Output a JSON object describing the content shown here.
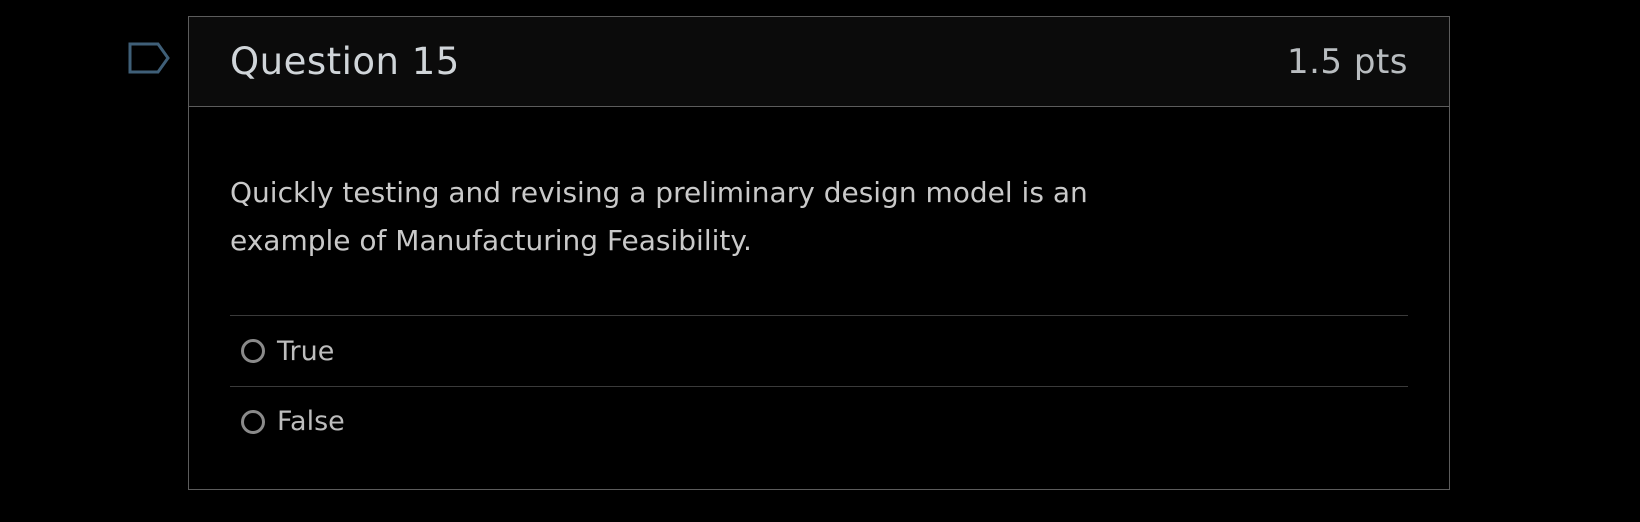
{
  "question": {
    "title": "Question 15",
    "points": "1.5 pts",
    "text_line1": "Quickly testing and revising a preliminary design model is an",
    "text_line2": "example of Manufacturing Feasibility.",
    "flag_icon": "flag-outline-icon",
    "answers": [
      {
        "label": "True",
        "selected": false
      },
      {
        "label": "False",
        "selected": false
      }
    ]
  },
  "colors": {
    "background": "#000000",
    "header_background": "#0b0b0b",
    "border": "#5c5c5c",
    "flag_outline": "#3f5f78",
    "text": "#c9c9c9"
  }
}
